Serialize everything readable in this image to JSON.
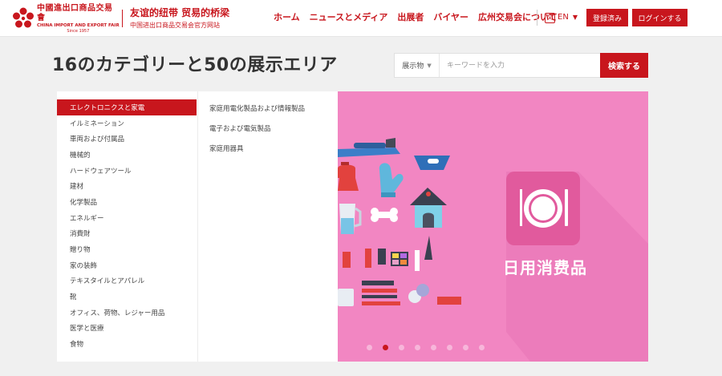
{
  "header": {
    "logo": {
      "cn": "中國進出口商品交易會",
      "en": "CHINA IMPORT AND EXPORT FAIR",
      "since": "Since 1957"
    },
    "slogan": {
      "main": "友谊的纽带 贸易的桥梁",
      "sub": "中国进出口商品交易会官方网站"
    },
    "nav": [
      {
        "label": "ホーム"
      },
      {
        "label": "ニュースとメディア"
      },
      {
        "label": "出展者"
      },
      {
        "label": "バイヤー"
      },
      {
        "label": "広州交易会について"
      }
    ],
    "language": "EN",
    "register_label": "登録済み",
    "login_label": "ログインする"
  },
  "main": {
    "title": "16のカテゴリーと50の展示エリア",
    "search": {
      "select_value": "展示物",
      "placeholder": "キーワードを入力",
      "button_label": "検索する"
    },
    "categories": [
      {
        "label": "エレクトロニクスと家電",
        "active": true
      },
      {
        "label": "イルミネーション"
      },
      {
        "label": "車両および付属品"
      },
      {
        "label": "機械的"
      },
      {
        "label": "ハードウェアツール"
      },
      {
        "label": "建材"
      },
      {
        "label": "化学製品"
      },
      {
        "label": "エネルギー"
      },
      {
        "label": "消費財"
      },
      {
        "label": "贈り物"
      },
      {
        "label": "家の装飾"
      },
      {
        "label": "テキスタイルとアパレル"
      },
      {
        "label": "靴"
      },
      {
        "label": "オフィス、荷物、レジャー用品"
      },
      {
        "label": "医学と医療"
      },
      {
        "label": "食物"
      }
    ],
    "subcategories": [
      {
        "label": "家庭用電化製品および情報製品"
      },
      {
        "label": "電子および電気製品"
      },
      {
        "label": "家庭用器具"
      }
    ],
    "banner": {
      "label": "日用消费品",
      "background_color": "#f286c2",
      "slide_count": 8,
      "active_slide": 2
    }
  },
  "colors": {
    "brand": "#c8161d",
    "page_background": "#f0f0f0"
  }
}
